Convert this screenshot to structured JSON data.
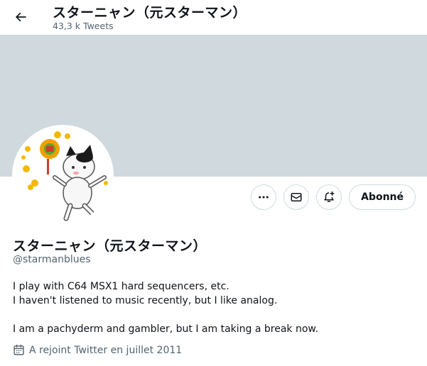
{
  "header": {
    "name": "スターニャン（元スターマン）",
    "tweet_count": "43,3 k Tweets"
  },
  "profile": {
    "name": "スターニャン（元スターマン）",
    "handle": "@starmanblues",
    "bio_lines": [
      "I play with C64 MSX1 hard sequencers, etc.",
      "I haven't listened to music recently, but I like analog.",
      "",
      "I am a pachyderm and gambler, but I am taking a break now."
    ],
    "joined": "A rejoint Twitter en juillet 2011"
  },
  "actions": {
    "follow_label": "Abonné"
  },
  "icons": {
    "back": "arrow-left-icon",
    "more": "more-dots-icon",
    "message": "envelope-icon",
    "notify": "bell-plus-icon",
    "calendar": "calendar-icon"
  },
  "colors": {
    "banner": "#cfd9de",
    "secondary_text": "#536471",
    "border": "#cfd9de"
  }
}
